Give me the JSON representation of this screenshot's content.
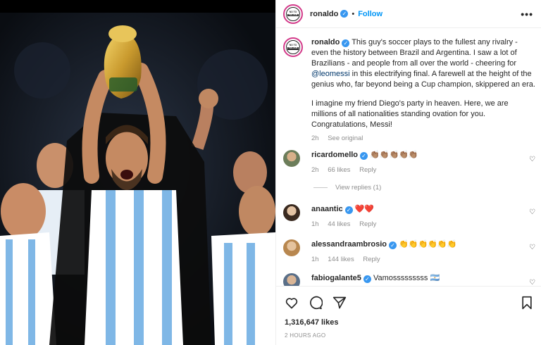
{
  "account": {
    "username": "ronaldo",
    "follow_label": "Follow",
    "avatar_text_top": "NO TO",
    "avatar_text_bar": "RACISM"
  },
  "caption": {
    "username": "ronaldo",
    "text_part1": "This guy's soccer plays to the fullest any rivalry - even the history between Brazil and Argentina. I saw a lot of Brazilians - and people from all over the world - cheering for ",
    "mention": "@leomessi",
    "text_part2": " in this electrifying final. A farewell at the height of the genius who, far beyond being a Cup champion, skippered an era.",
    "paragraph2": "I imagine my friend Diego's party in heaven. Here, we are millions of all nationalities standing ovation for you. Congratulations, Messi!",
    "time": "2h",
    "see_original": "See original"
  },
  "comments": [
    {
      "username": "ricardomello",
      "text": "👏🏽👏🏽👏🏽👏🏽👏🏽",
      "time": "2h",
      "likes": "66 likes",
      "reply": "Reply",
      "view_replies": "View replies (1)"
    },
    {
      "username": "anaantic",
      "text": "❤️❤️",
      "time": "1h",
      "likes": "44 likes",
      "reply": "Reply"
    },
    {
      "username": "alessandraambrosio",
      "text": "👏👏👏👏👏👏",
      "time": "1h",
      "likes": "144 likes",
      "reply": "Reply"
    },
    {
      "username": "fabiogalante5",
      "text": "Vamosssssssss 🇦🇷"
    }
  ],
  "footer": {
    "likes_count": "1,316,647 likes",
    "posted": "2 HOURS AGO"
  },
  "icons": {
    "like": "heart-outline-icon",
    "comment": "comment-bubble-icon",
    "share": "paper-plane-icon",
    "save": "bookmark-icon",
    "more": "more-options-icon"
  },
  "colors": {
    "link_blue": "#0095f6",
    "verified_blue": "#3897f0",
    "muted": "#8e8e8e",
    "heart_red": "#ed4956"
  }
}
